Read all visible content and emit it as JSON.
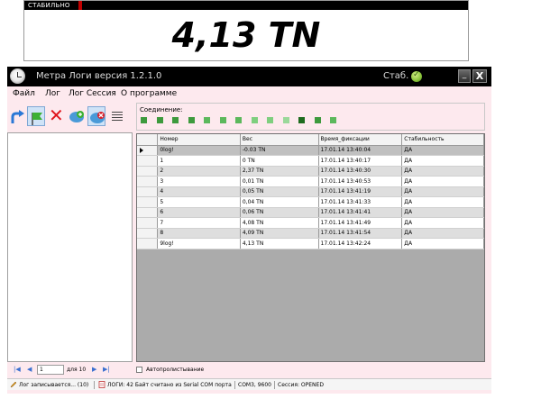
{
  "display": {
    "status": "СТАБИЛЬНО",
    "value": "4,13 TN"
  },
  "window": {
    "title": "Метра Логи версия 1.2.1.0",
    "stab_label": "Стаб.",
    "minimize_label": "_",
    "close_label": "X"
  },
  "menu": {
    "items": [
      "Файл",
      "Лог",
      "Лог Сессия",
      "О программе"
    ]
  },
  "connection": {
    "label": "Соединение:",
    "squares": [
      "#3d9a3d",
      "#3d9a3d",
      "#3d9a3d",
      "#3d9a3d",
      "#5cb85c",
      "#5cb85c",
      "#5cb85c",
      "#7fcf7f",
      "#7fcf7f",
      "#9ad89a",
      "#1e6b1e",
      "#3d9a3d",
      "#5cb85c"
    ]
  },
  "table": {
    "columns": [
      "Номер",
      "Вес",
      "Время_фиксации",
      "Стабильность"
    ],
    "rows": [
      {
        "num": "0log!",
        "weight": "-0.03 TN",
        "time": "17.01.14 13:40:04",
        "stab": "ДА"
      },
      {
        "num": "1",
        "weight": "0 TN",
        "time": "17.01.14 13:40:17",
        "stab": "ДА"
      },
      {
        "num": "2",
        "weight": "2,37 TN",
        "time": "17.01.14 13:40:30",
        "stab": "ДА"
      },
      {
        "num": "3",
        "weight": "0,01 TN",
        "time": "17.01.14 13:40:53",
        "stab": "ДА"
      },
      {
        "num": "4",
        "weight": "0,05 TN",
        "time": "17.01.14 13:41:19",
        "stab": "ДА"
      },
      {
        "num": "5",
        "weight": "0,04 TN",
        "time": "17.01.14 13:41:33",
        "stab": "ДА"
      },
      {
        "num": "6",
        "weight": "0,06 TN",
        "time": "17.01.14 13:41:41",
        "stab": "ДА"
      },
      {
        "num": "7",
        "weight": "4,08 TN",
        "time": "17.01.14 13:41:49",
        "stab": "ДА"
      },
      {
        "num": "8",
        "weight": "4,09 TN",
        "time": "17.01.14 13:41:54",
        "stab": "ДА"
      },
      {
        "num": "9log!",
        "weight": "4,13 TN",
        "time": "17.01.14 13:42:24",
        "stab": "ДА"
      }
    ]
  },
  "pager": {
    "current": "1",
    "total_label": "для 10"
  },
  "autoscroll_label": "Автопролистывание",
  "statusbar": {
    "log_status": "Лог записывается... (10)",
    "message": "ЛОГИ: 42 Байт считано из Serial COM порта",
    "port": "COM3, 9600",
    "session": "Сессия: OPENED"
  }
}
